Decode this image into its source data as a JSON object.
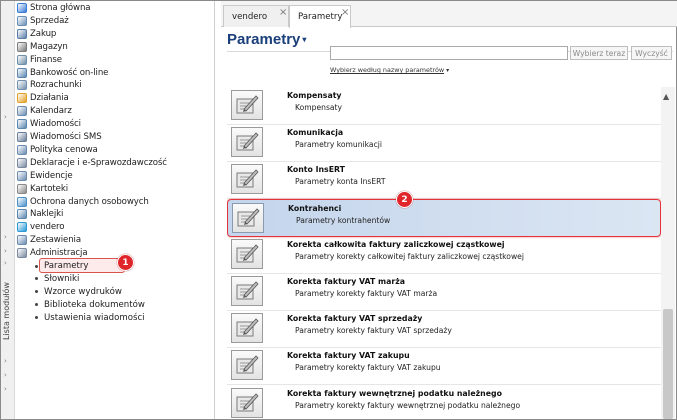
{
  "sidebar_strip": {
    "label": "Lista modułów"
  },
  "tree": {
    "modules": [
      {
        "label": "Strona główna",
        "icon": "home-icon",
        "color": "#3a7bd5"
      },
      {
        "label": "Sprzedaż",
        "icon": "sales-icon",
        "color": "#6a8fb5"
      },
      {
        "label": "Zakup",
        "icon": "purchase-icon",
        "color": "#5a7ea8"
      },
      {
        "label": "Magazyn",
        "icon": "warehouse-icon",
        "color": "#7a7a7a"
      },
      {
        "label": "Finanse",
        "icon": "finance-icon",
        "color": "#6f8fa8"
      },
      {
        "label": "Bankowość on-line",
        "icon": "bank-icon",
        "color": "#5b86b0"
      },
      {
        "label": "Rozrachunki",
        "icon": "settlements-icon",
        "color": "#7390ad"
      },
      {
        "label": "Działania",
        "icon": "actions-icon",
        "color": "#e2a12a"
      },
      {
        "label": "Kalendarz",
        "icon": "calendar-icon",
        "color": "#6b8cb0"
      },
      {
        "label": "Wiadomości",
        "icon": "messages-icon",
        "color": "#5b86b0"
      },
      {
        "label": "Wiadomości SMS",
        "icon": "sms-icon",
        "color": "#6a7f9a"
      },
      {
        "label": "Polityka cenowa",
        "icon": "pricing-icon",
        "color": "#6b8cb0"
      },
      {
        "label": "Deklaracje i e-Sprawozdawczość",
        "icon": "declarations-icon",
        "color": "#7a8aa0"
      },
      {
        "label": "Ewidencje",
        "icon": "records-icon",
        "color": "#6b8cb0"
      },
      {
        "label": "Kartoteki",
        "icon": "files-icon",
        "color": "#8a8a8a"
      },
      {
        "label": "Ochrona danych osobowych",
        "icon": "data-protection-icon",
        "color": "#4a90c8"
      },
      {
        "label": "Naklejki",
        "icon": "stickers-icon",
        "color": "#5b86b0"
      },
      {
        "label": "vendero",
        "icon": "vendero-icon",
        "color": "#2a9ad6"
      },
      {
        "label": "Zestawienia",
        "icon": "reports-icon",
        "color": "#6b8cb0"
      },
      {
        "label": "Administracja",
        "icon": "admin-icon",
        "color": "#7a8aa0"
      }
    ],
    "admin_children": [
      {
        "label": "Parametry",
        "selected": true
      },
      {
        "label": "Słowniki"
      },
      {
        "label": "Wzorce wydruków"
      },
      {
        "label": "Biblioteka dokumentów"
      },
      {
        "label": "Ustawienia wiadomości"
      }
    ]
  },
  "tabs": [
    {
      "label": "vendero",
      "active": false
    },
    {
      "label": "Parametry",
      "active": true
    }
  ],
  "header": {
    "title": "Parametry",
    "search_placeholder": "",
    "search_button": "Wybierz teraz",
    "clear_button": "Wyczyść",
    "search_mode": "Wybierz według nazwy parametrów"
  },
  "items": [
    {
      "name": "Kompensaty",
      "desc": "Kompensaty"
    },
    {
      "name": "Komunikacja",
      "desc": "Parametry komunikacji"
    },
    {
      "name": "Konto InsERT",
      "desc": "Parametry konta InsERT"
    },
    {
      "name": "Kontrahenci",
      "desc": "Parametry kontrahentów",
      "selected": true
    },
    {
      "name": "Korekta całkowita faktury zaliczkowej cząstkowej",
      "desc": "Parametry korekty całkowitej faktury zaliczkowej cząstkowej"
    },
    {
      "name": "Korekta faktury VAT marża",
      "desc": "Parametry korekty faktury VAT marża"
    },
    {
      "name": "Korekta faktury VAT sprzedaży",
      "desc": "Parametry korekty faktury VAT sprzedaży"
    },
    {
      "name": "Korekta faktury VAT zakupu",
      "desc": "Parametry korekty faktury VAT zakupu"
    },
    {
      "name": "Korekta faktury wewnętrznej podatku należnego",
      "desc": "Parametry korekty faktury wewnętrznej podatku należnego"
    }
  ],
  "badges": {
    "one": "1",
    "two": "2"
  },
  "colors": {
    "accent": "#1a3f7a",
    "highlight": "#e3323a",
    "selection": "#c4d5ec"
  }
}
